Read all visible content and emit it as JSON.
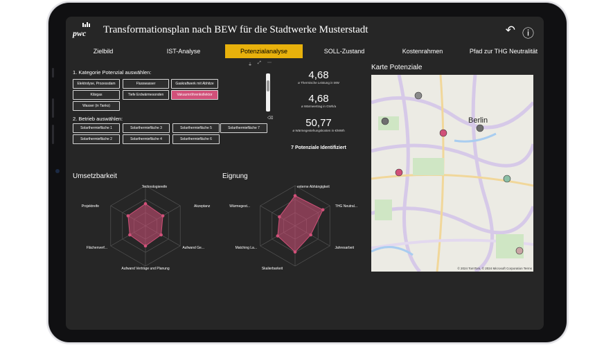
{
  "header": {
    "logo_text": "pwc",
    "title": "Transformationsplan nach BEW für die Stadtwerke Musterstadt",
    "icons": [
      "back-icon",
      "info-icon"
    ]
  },
  "tabs": [
    {
      "label": "Zielbild",
      "active": false
    },
    {
      "label": "IST-Analyse",
      "active": false
    },
    {
      "label": "Potenzialanalyse",
      "active": true
    },
    {
      "label": "SOLL-Zustand",
      "active": false
    },
    {
      "label": "Kostenrahmen",
      "active": false
    },
    {
      "label": "Pfad zur THG Neutralität",
      "active": false
    }
  ],
  "filters": {
    "category_label": "1. Kategorie Potenzial auswählen:",
    "category_chips": [
      "Elektrolyse, Prozessdam",
      "Flusswasser",
      "Gaskraftwerk mit Abhitze",
      "Klärgas",
      "Tiefe Erdwärmesonden",
      "Vakuumröhrenkollektor",
      "Wasser (in Tanks)"
    ],
    "category_selected": "Vakuumröhrenkollektor",
    "operation_label": "2. Betrieb auswählen:",
    "operation_chips": [
      "Solarthermiefläche 1",
      "Solarthermiefläche 3",
      "Solarthermiefläche 5",
      "Solarthermiefläche 7",
      "Solarthermiefläche 2",
      "Solarthermiefläche 4",
      "Solarthermiefläche 6"
    ]
  },
  "kpis": [
    {
      "value": "4,68",
      "label": "ø Thermische Leistung in MW"
    },
    {
      "value": "4,68",
      "label": "ø Wärmeertrag in GWh/a"
    },
    {
      "value": "50,77",
      "label": "ø Wärmegestehungskosten in €/MWh"
    }
  ],
  "kpi_summary": "7 Potenziale Identifiziert",
  "map": {
    "title": "Karte Potenziale",
    "city_label": "Berlin",
    "copyright": "© 2024 TomTom, © 2024 Microsoft Corporation  Terms",
    "markers": [
      {
        "name": "marker-1",
        "color": "#8a8a8a"
      },
      {
        "name": "marker-2",
        "color": "#6f6f6f"
      },
      {
        "name": "marker-3",
        "color": "#d15079"
      },
      {
        "name": "marker-4",
        "color": "#6f6f6f"
      },
      {
        "name": "marker-5",
        "color": "#d15079"
      },
      {
        "name": "marker-6",
        "color": "#8bbfa6"
      },
      {
        "name": "marker-7",
        "color": "#c9a4a4"
      },
      {
        "name": "marker-8",
        "color": "#6f6f6f"
      }
    ]
  },
  "radar_umsetzbarkeit": {
    "title": "Umsetzbarkeit",
    "axes": [
      "Technologiereife",
      "Akzeptanz",
      "Aufwand Ge...",
      "Aufwand Verträge und Planung",
      "Flächenverf...",
      "Projektreife"
    ],
    "values": [
      0.55,
      0.5,
      0.45,
      0.5,
      0.45,
      0.5
    ]
  },
  "radar_eignung": {
    "title": "Eignung",
    "axes": [
      "externe Abhängigkeit",
      "THG Neutral...",
      "Jahresarbeit",
      "Skalierbarkeit",
      "Matching La...",
      "Wärmegest..."
    ],
    "values": [
      0.75,
      0.8,
      0.45,
      0.65,
      0.5,
      0.45
    ]
  },
  "colors": {
    "accent": "#e8b10c",
    "series": "#d15079",
    "background": "#262626"
  }
}
